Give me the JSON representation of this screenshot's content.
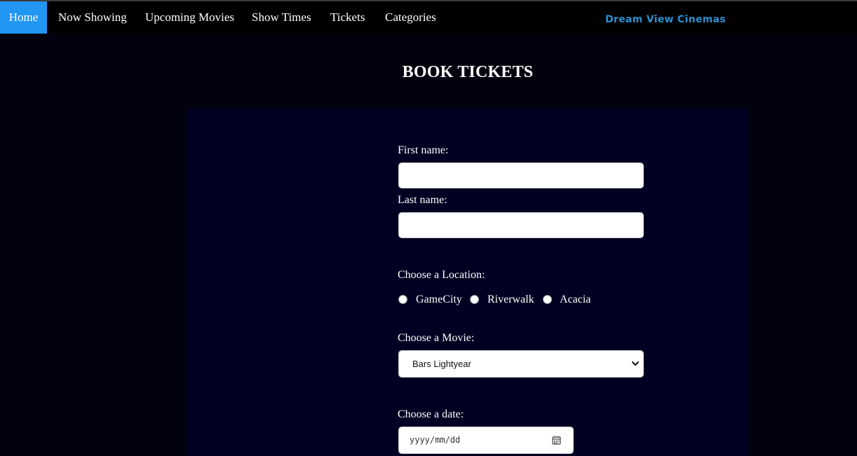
{
  "nav": {
    "items": [
      {
        "label": "Home",
        "active": true
      },
      {
        "label": "Now Showing"
      },
      {
        "label": "Upcoming Movies"
      },
      {
        "label": "Show Times"
      },
      {
        "label": "Tickets"
      },
      {
        "label": "Categories"
      }
    ],
    "brand": "Dream View Cinemas"
  },
  "page": {
    "title": "BOOK TICKETS"
  },
  "form": {
    "first_name_label": "First name:",
    "first_name_value": "",
    "last_name_label": "Last name:",
    "last_name_value": "",
    "location_label": "Choose a Location:",
    "locations": [
      "GameCity",
      "Riverwalk",
      "Acacia"
    ],
    "movie_label": "Choose a Movie:",
    "movie_selected": "Bars Lightyear",
    "date_label": "Choose a date:",
    "date_placeholder": "yyyy/mm/dd"
  },
  "colors": {
    "active_nav": "#2196f3",
    "brand": "#2a8fd0",
    "page_background": "#02020f",
    "panel_background": "#000022"
  },
  "icons": {
    "select_arrow": "chevron-down-icon",
    "date_picker": "calendar-icon"
  }
}
